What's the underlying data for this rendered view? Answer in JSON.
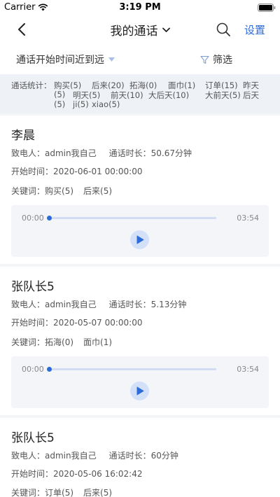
{
  "status_bar": {
    "carrier": "Carrier",
    "time": "3:19 PM"
  },
  "nav": {
    "title": "我的通话",
    "settings_label": "设置"
  },
  "filter_bar": {
    "sort_label": "通话开始时间近到远",
    "filter_label": "筛选"
  },
  "stats": {
    "label": "通话统计：",
    "items": [
      "购买(5)",
      "后来(20)",
      "拓海(0)",
      "面巾(1)",
      "订单(15)",
      "昨天",
      "(5)",
      "明天(5)",
      "前天(10)",
      "大后天(10)",
      "大前天(5)",
      "后天",
      "(5)",
      "ji(5)",
      "xiao(5)"
    ]
  },
  "calls": [
    {
      "name": "李晨",
      "caller_label": "致电人：",
      "caller": "admin我自己",
      "duration_label": "通话时长：",
      "duration": "50.67分钟",
      "start_label": "开始时间：",
      "start": "2020-06-01 00:00:00",
      "keywords_label": "关键词：",
      "keywords": [
        "购买(5)",
        "后来(5)"
      ],
      "player": {
        "current": "00:00",
        "total": "03:54",
        "progress": 0
      }
    },
    {
      "name": "张队长5",
      "caller_label": "致电人：",
      "caller": "admin我自己",
      "duration_label": "通话时长：",
      "duration": "5.13分钟",
      "start_label": "开始时间：",
      "start": "2020-05-07 00:00:00",
      "keywords_label": "关键词：",
      "keywords": [
        "拓海(0)",
        "面巾(1)"
      ],
      "player": {
        "current": "00:00",
        "total": "03:54",
        "progress": 0
      }
    },
    {
      "name": "张队长5",
      "caller_label": "致电人：",
      "caller": "admin我自己",
      "duration_label": "通话时长：",
      "duration": "60分钟",
      "start_label": "开始时间：",
      "start": "2020-05-06 16:02:42",
      "keywords_label": "关键词：",
      "keywords": [
        "订单(5)",
        "后来(5)"
      ]
    }
  ],
  "colors": {
    "accent": "#2d6bd8",
    "stats_bg": "#eef1f6",
    "player_bg": "#f3f5f9"
  }
}
